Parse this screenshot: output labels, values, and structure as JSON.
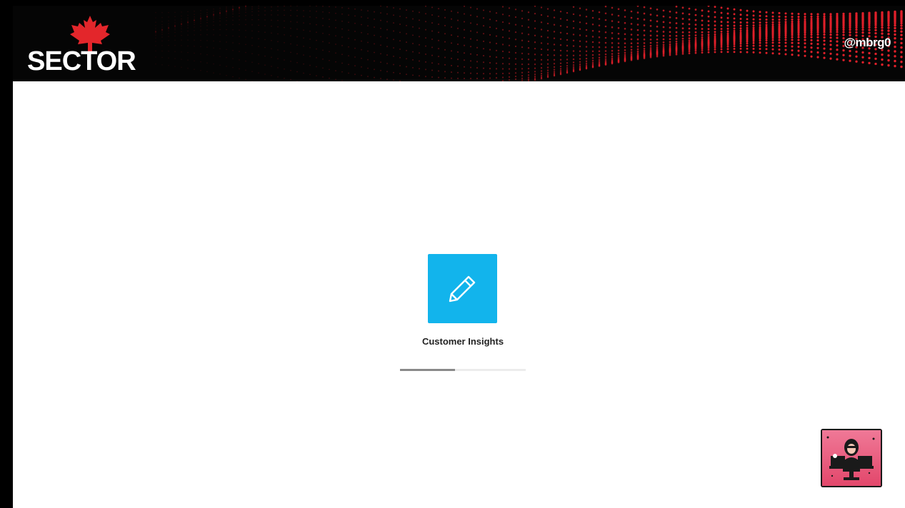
{
  "banner": {
    "logo_text": "SECTOR",
    "user_handle": "@mbrg0",
    "background_color": "#050505",
    "dot_color": "#e0202a"
  },
  "loading_screen": {
    "app_name": "Customer Insights",
    "app_icon": "pencil-icon",
    "tile_color": "#12b4ec",
    "progress": 0.44
  },
  "overlay": {
    "avatar_icon": "presenter-avatar-icon"
  }
}
